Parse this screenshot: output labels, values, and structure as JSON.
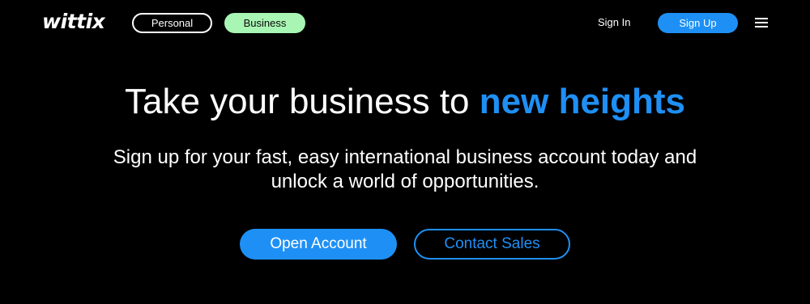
{
  "header": {
    "logo_text": "wittix",
    "segments": [
      {
        "label": "Personal",
        "active": false
      },
      {
        "label": "Business",
        "active": true
      }
    ],
    "sign_in_label": "Sign In",
    "sign_up_label": "Sign Up",
    "menu_icon": "hamburger-menu-icon"
  },
  "hero": {
    "title_plain": "Take your business to",
    "title_accent": "new heights",
    "subtitle_line1": "Sign up for your fast, easy international business account today and",
    "subtitle_line2": "unlock a world of opportunities.",
    "primary_cta_label": "Open Account",
    "secondary_cta_label": "Contact Sales"
  },
  "colors": {
    "background": "#000000",
    "accent_blue": "#1e90f5",
    "business_pill_green": "#a8f5b4",
    "text": "#ffffff"
  }
}
